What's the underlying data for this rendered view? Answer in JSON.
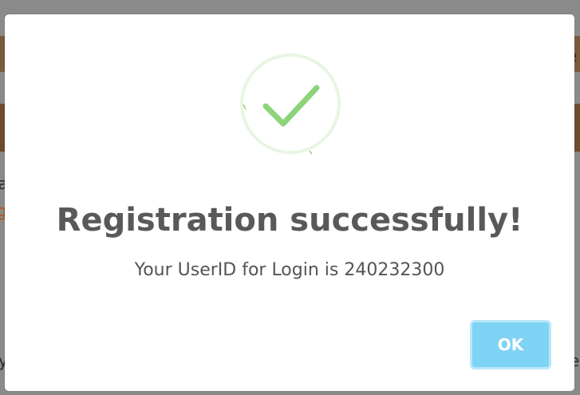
{
  "dialog": {
    "title": "Registration successfully!",
    "message": "Your UserID for Login is 240232300",
    "ok_label": "OK",
    "icon": "success-check-icon"
  },
  "background": {
    "fragments": [
      "e",
      "ia",
      "g",
      "y",
      "e"
    ]
  },
  "colors": {
    "success": "#8cd37a",
    "success_ring": "#e8f5e2",
    "ok_button": "#7fd3f5",
    "title_text": "#595959",
    "overlay": "#8a8a8a"
  }
}
